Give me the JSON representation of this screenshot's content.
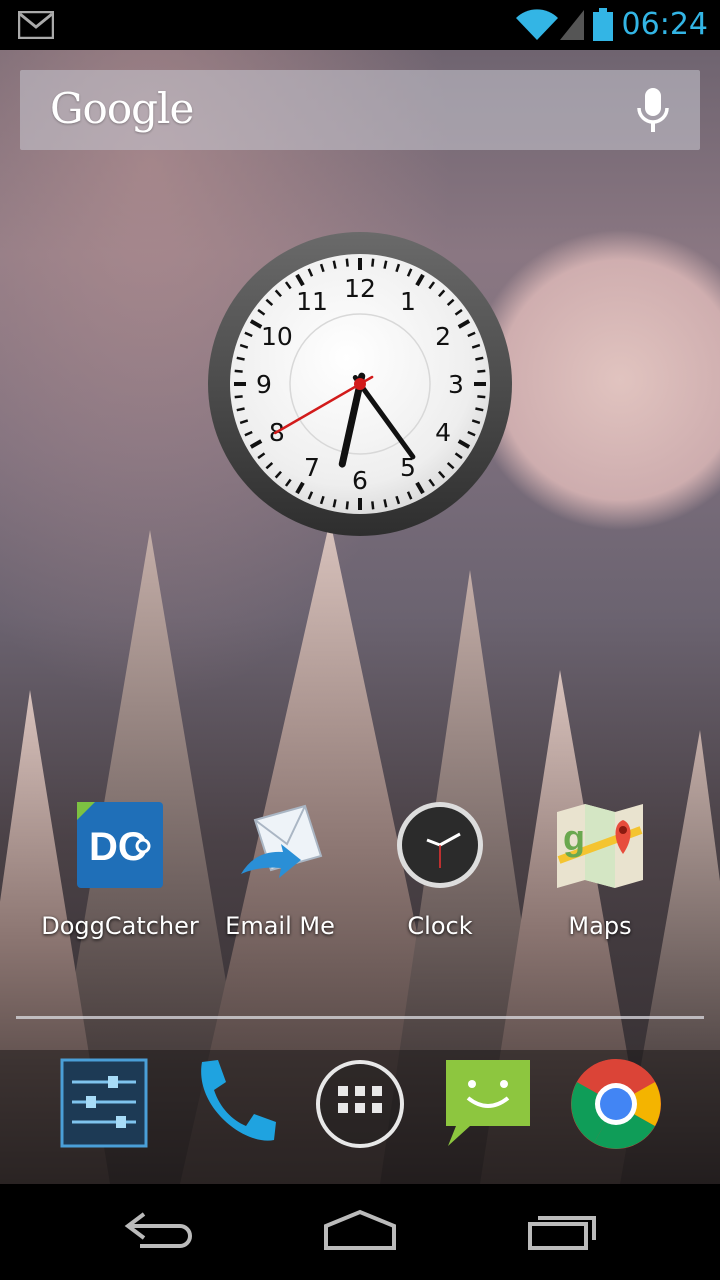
{
  "status_bar": {
    "time": "06:24",
    "icons": [
      "gmail-icon",
      "wifi-icon",
      "signal-icon",
      "battery-icon"
    ],
    "accent_color": "#33b5e5"
  },
  "search_widget": {
    "logo_text": "Google",
    "icon": "mic-icon"
  },
  "clock_widget": {
    "numbers": [
      "12",
      "1",
      "2",
      "3",
      "4",
      "5",
      "6",
      "7",
      "8",
      "9",
      "10",
      "11"
    ],
    "hour_hand_minutes": 385,
    "minute_hand": 24,
    "second_hand": 40
  },
  "apps": [
    {
      "label": "DoggCatcher",
      "icon": "doggcatcher-icon"
    },
    {
      "label": "Email Me",
      "icon": "email-icon"
    },
    {
      "label": "Clock",
      "icon": "clock-icon"
    },
    {
      "label": "Maps",
      "icon": "maps-icon"
    }
  ],
  "dock": [
    {
      "icon": "settings-icon"
    },
    {
      "icon": "phone-icon"
    },
    {
      "icon": "app-drawer-icon"
    },
    {
      "icon": "messaging-icon"
    },
    {
      "icon": "chrome-icon"
    }
  ],
  "nav_bar": {
    "buttons": [
      "back-icon",
      "home-icon",
      "recent-apps-icon"
    ]
  }
}
